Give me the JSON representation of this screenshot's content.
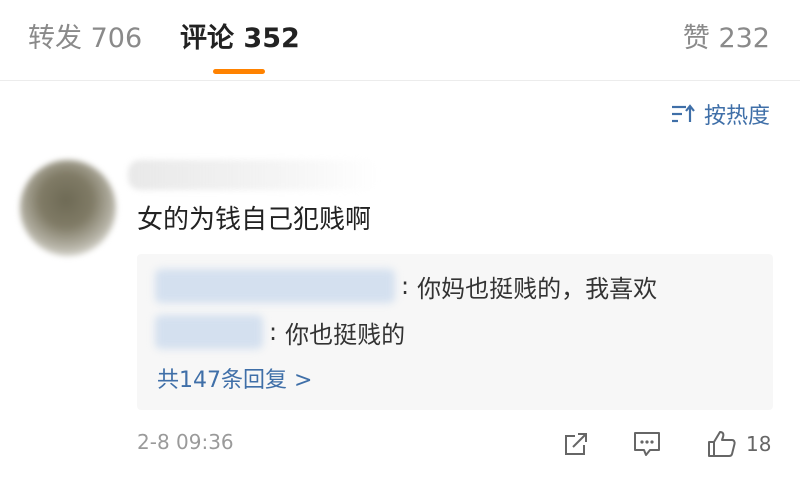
{
  "tabs": {
    "repost": {
      "label": "转发",
      "count": "706"
    },
    "comment": {
      "label": "评论",
      "count": "352"
    },
    "like": {
      "label": "赞",
      "count": "232"
    }
  },
  "sort": {
    "label": "按热度",
    "icon": "sort-icon"
  },
  "comment": {
    "text": "女的为钱自己犯贱啊",
    "time": "2-8 09:36",
    "likes": "18",
    "replies": [
      {
        "text": "你妈也挺贱的，我喜欢"
      },
      {
        "text": "你也挺贱的"
      }
    ],
    "more_replies": "共147条回复 >"
  },
  "colors": {
    "accent": "#ff8200",
    "link": "#3f6fa8"
  }
}
